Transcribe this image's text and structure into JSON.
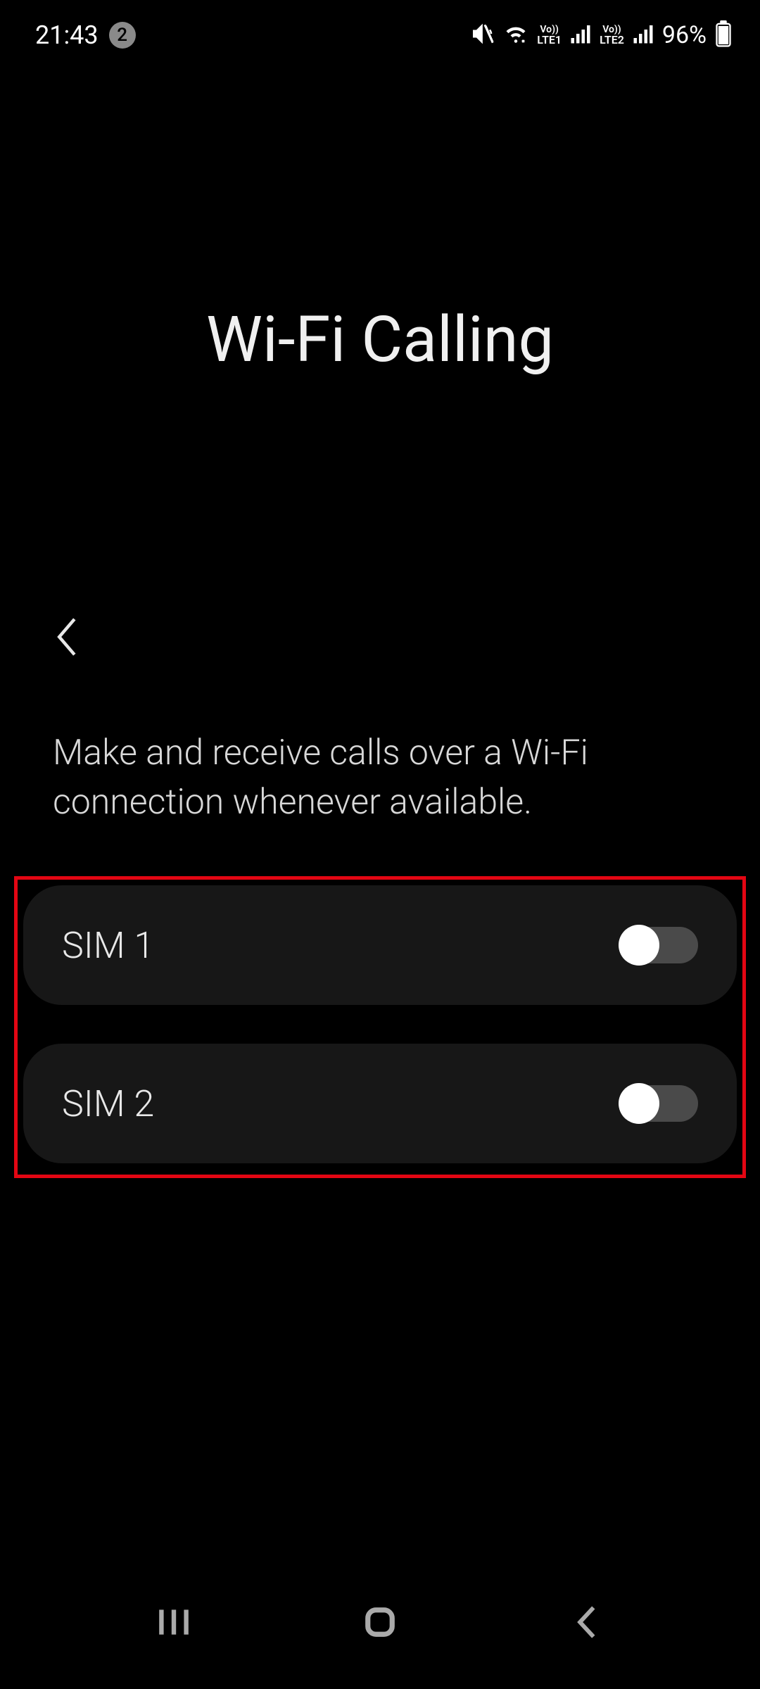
{
  "status": {
    "time": "21:43",
    "notification_count": "2",
    "volte1_top": "Vo))",
    "volte1_bot": "LTE1",
    "volte2_top": "Vo))",
    "volte2_bot": "LTE2",
    "battery_pct": "96%"
  },
  "page": {
    "title": "Wi-Fi Calling",
    "description": "Make and receive calls over a Wi-Fi connection whenever available."
  },
  "sims": [
    {
      "label": "SIM 1",
      "enabled": false
    },
    {
      "label": "SIM 2",
      "enabled": false
    }
  ]
}
